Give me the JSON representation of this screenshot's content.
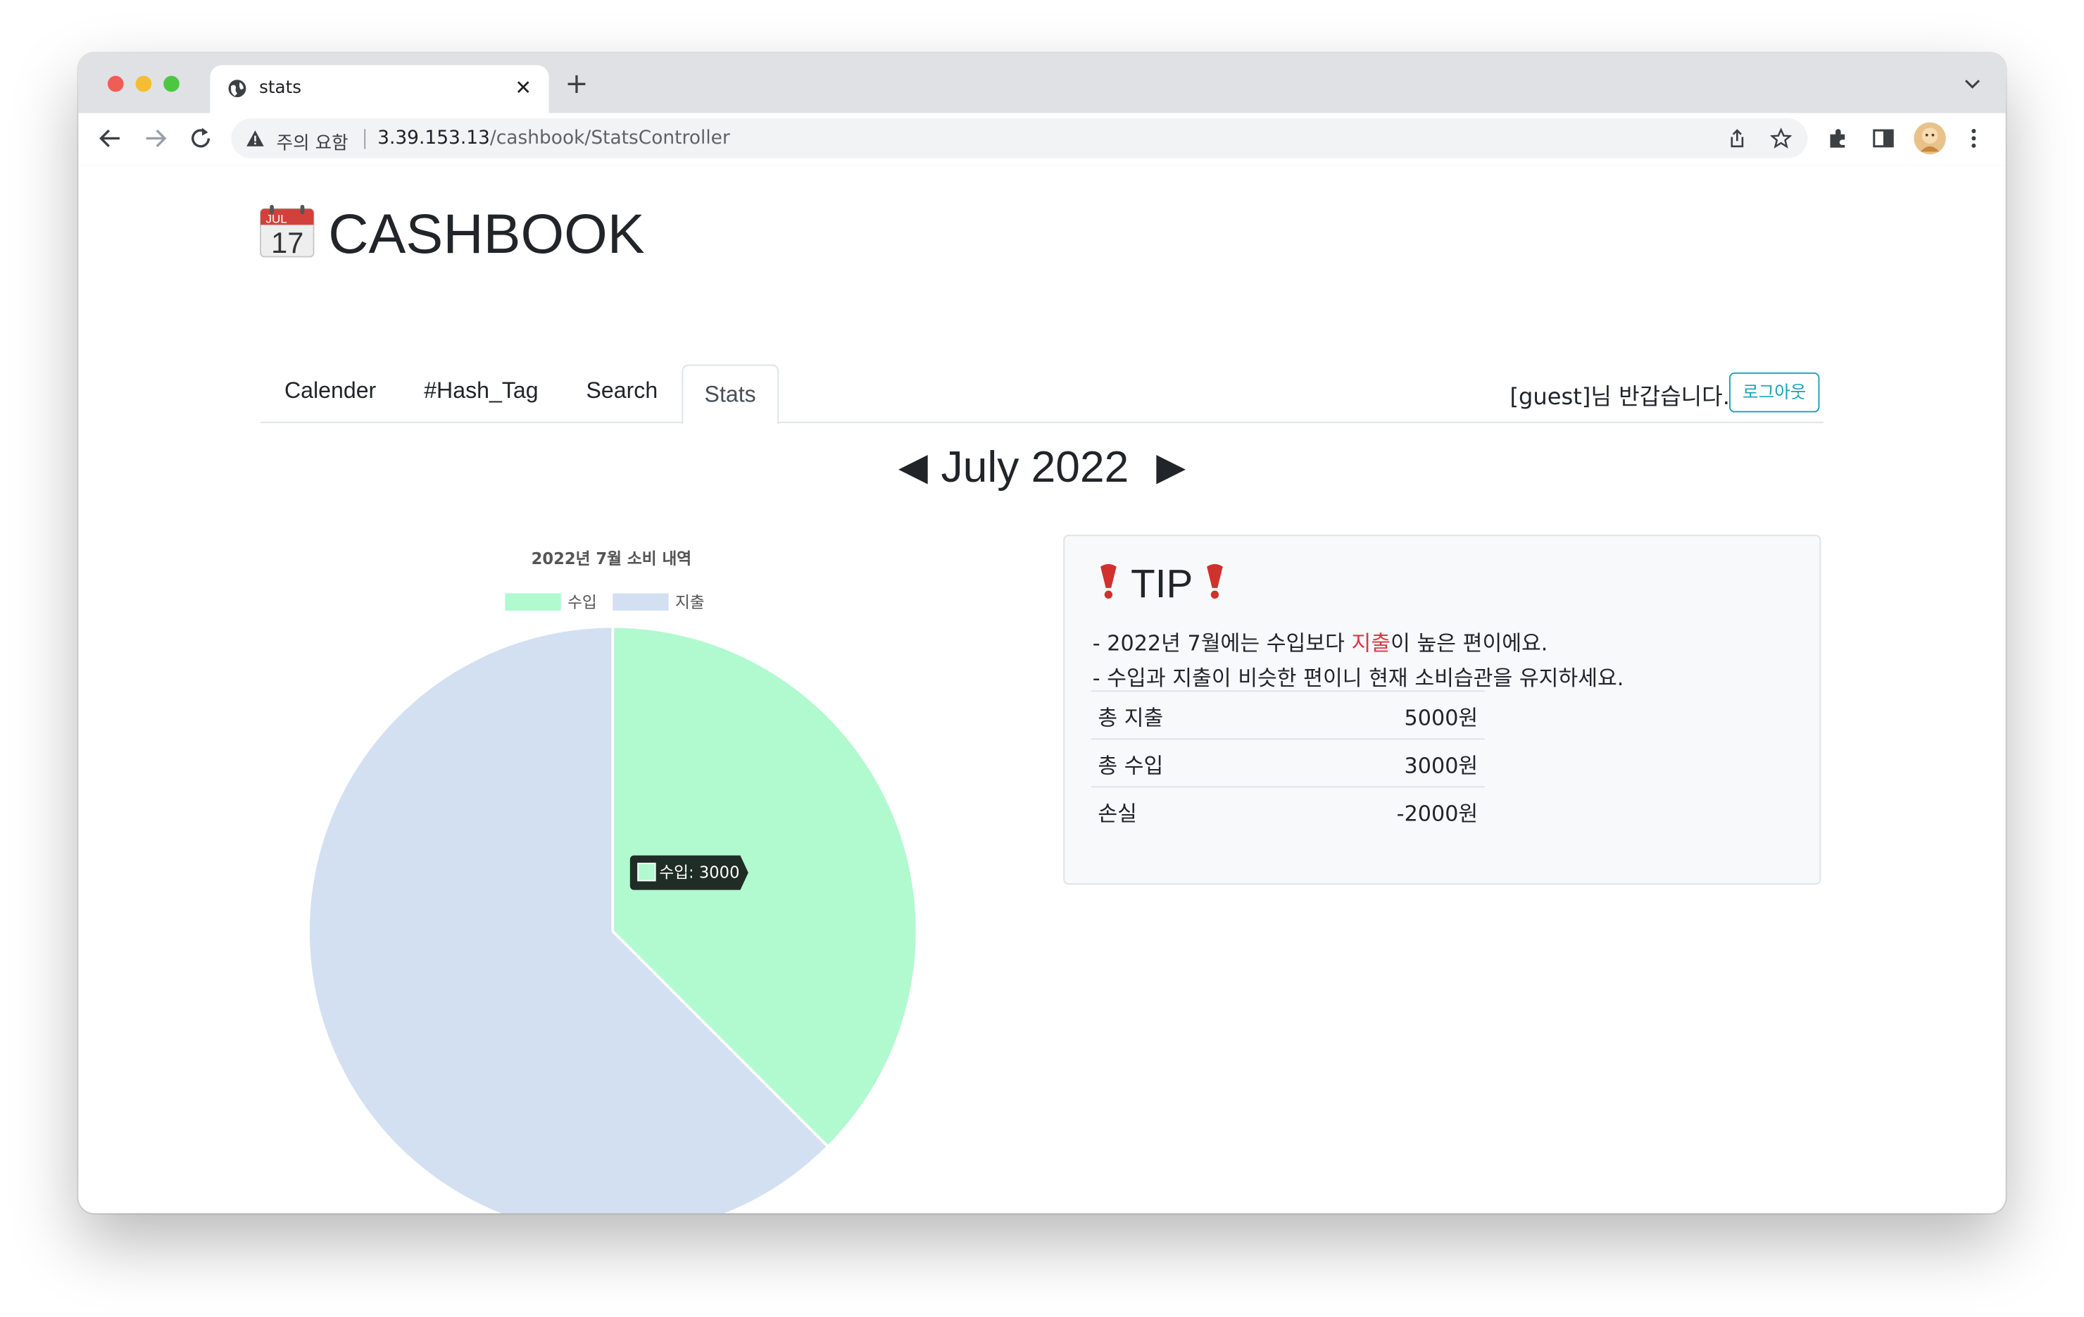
{
  "browser": {
    "tab_title": "stats",
    "security_label": "주의 요함",
    "url_host": "3.39.153.13",
    "url_path": "/cashbook/StatsController"
  },
  "app": {
    "logo_date_month": "JUL",
    "logo_date_day": "17",
    "logo_text": "CASHBOOK",
    "nav": [
      {
        "label": "Calender"
      },
      {
        "label": "#Hash_Tag"
      },
      {
        "label": "Search"
      },
      {
        "label": "Stats",
        "active": true
      }
    ],
    "greeting": "[guest]님 반갑습니다.",
    "logout_label": "로그아웃",
    "month_label": "July 2022"
  },
  "chart_data": {
    "type": "pie",
    "title": "2022년 7월 소비 내역",
    "categories": [
      "수입",
      "지출"
    ],
    "values": [
      3000,
      5000
    ],
    "colors": [
      "#b1f9cf",
      "#d3e0f2"
    ],
    "legend": "top",
    "tooltip": "수입: 3000"
  },
  "tip": {
    "title": "TIP",
    "lines": [
      {
        "before": "- 2022년 7월에는 수입보다 ",
        "highlight": "지출",
        "after": "이 높은 편이에요."
      },
      {
        "text": "- 수입과 지출이 비슷한 편이니 현재 소비습관을 유지하세요."
      }
    ],
    "rows": [
      {
        "label": "총 지출",
        "value": "5000원"
      },
      {
        "label": "총 수입",
        "value": "3000원"
      },
      {
        "label": "손실",
        "value": "-2000원"
      }
    ]
  }
}
